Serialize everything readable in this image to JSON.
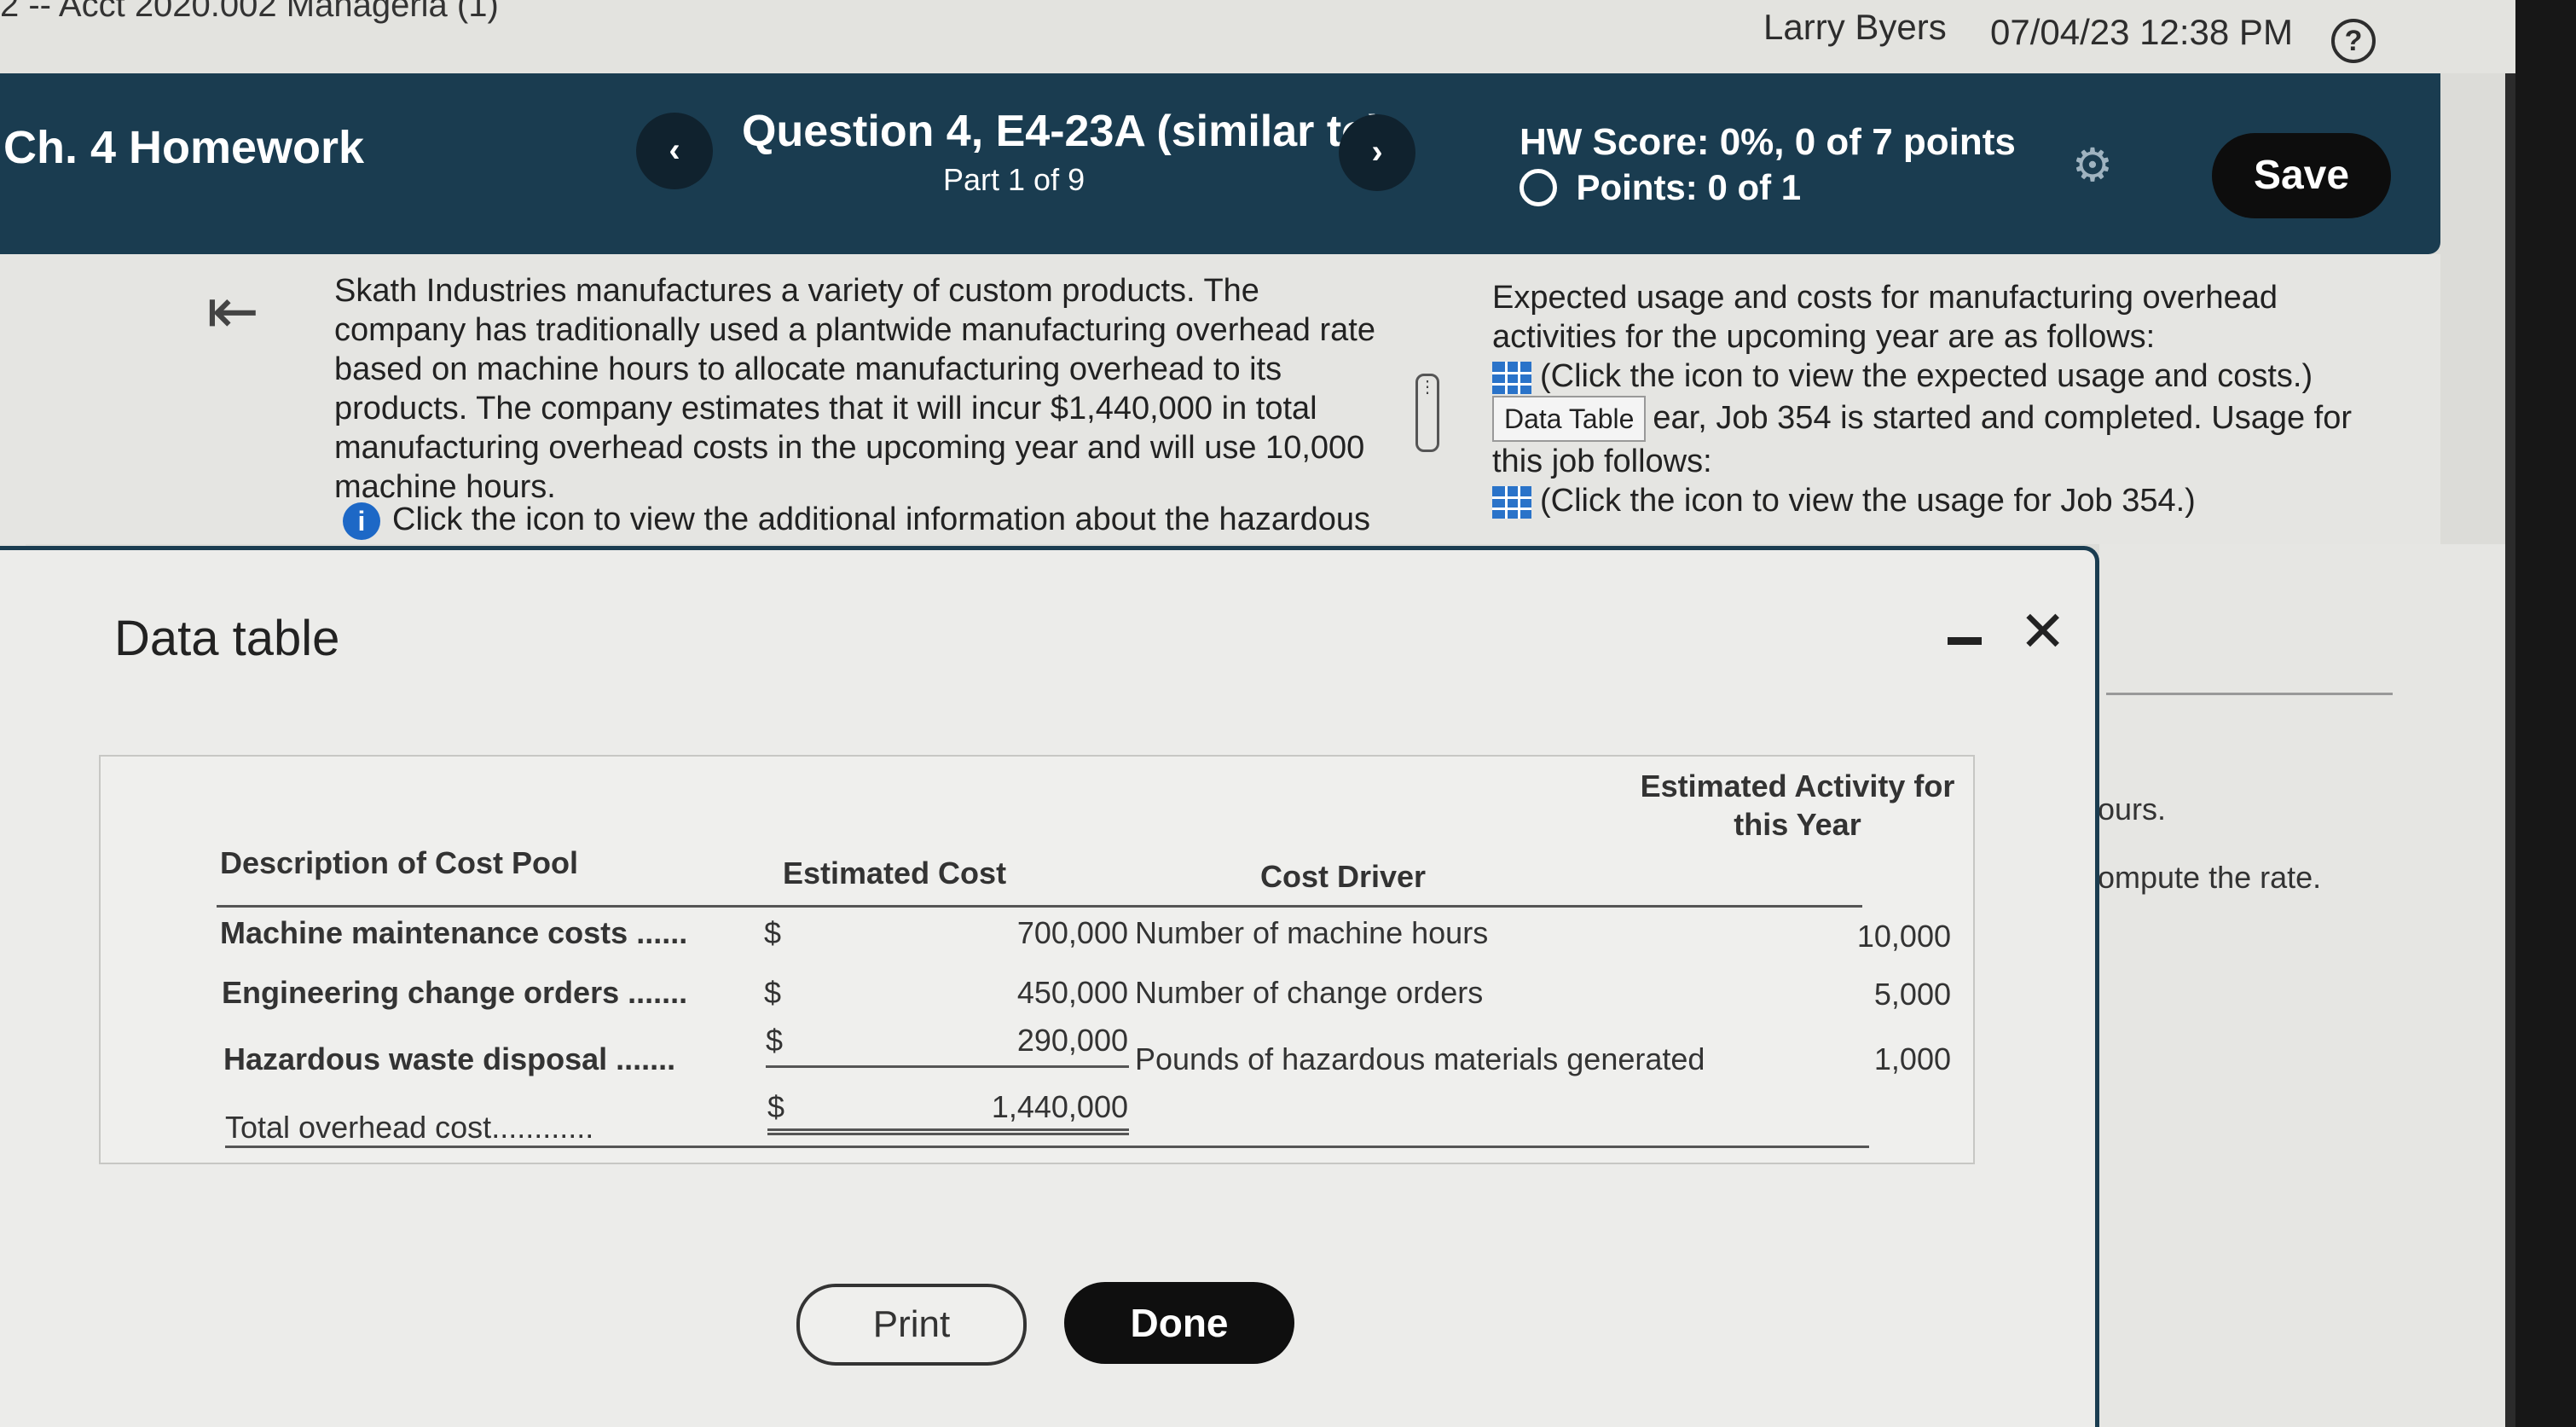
{
  "system": {
    "course_title": "2 -- Acct 2020.002 Manageria (1)",
    "user_name": "Larry Byers",
    "datetime": "07/04/23 12:38 PM",
    "help_icon": "question-circle-icon"
  },
  "header": {
    "homework_title": "Ch. 4 Homework",
    "prev_label": "‹",
    "next_label": "›",
    "question_title": "Question 4, E4-23A (similar to)",
    "question_part": "Part 1 of 9",
    "hw_score": "HW Score: 0%, 0 of 7 points",
    "points": "Points: 0 of 1",
    "save_label": "Save",
    "bg_color": "#1a3c50"
  },
  "question": {
    "left_paragraph": "Skath Industries manufactures a variety of custom products. The company has traditionally used a plantwide manufacturing overhead rate based on machine hours to allocate manufacturing overhead to its products. The company estimates that it will incur $1,440,000 in total manufacturing overhead costs in the upcoming year and will use 10,000 machine hours.",
    "info_link": "Click the icon to view the additional information about the hazardous",
    "right_intro": "Expected usage and costs for manufacturing overhead activities for the upcoming year are as follows:",
    "usage_link": "(Click the icon to view the expected usage and costs.)",
    "tooltip": "Data Table",
    "job_text": "ear, Job 354 is started and completed. Usage for this job follows:",
    "job_link": "(Click the icon to view the usage for Job 354.)"
  },
  "behind": {
    "fragment1": "ours.",
    "fragment2": "ompute the rate."
  },
  "modal": {
    "title": "Data table",
    "print_label": "Print",
    "done_label": "Done",
    "columns": {
      "description": "Description of Cost Pool",
      "cost": "Estimated Cost",
      "driver": "Cost Driver",
      "activity": "Estimated Activity for this Year"
    },
    "rows": [
      {
        "description": "Machine maintenance costs",
        "dots": "......",
        "currency": "$",
        "cost": "700,000",
        "driver": "Number of machine hours",
        "activity": "10,000"
      },
      {
        "description": "Engineering change orders",
        "dots": ".......",
        "currency": "$",
        "cost": "450,000",
        "driver": "Number of change orders",
        "activity": "5,000"
      },
      {
        "description": "Hazardous waste disposal",
        "dots": ".......",
        "currency": "$",
        "cost": "290,000",
        "driver": "Pounds of hazardous materials generated",
        "activity": "1,000"
      }
    ],
    "total": {
      "description": "Total overhead cost",
      "dots": "............",
      "currency": "$",
      "cost": "1,440,000"
    }
  }
}
